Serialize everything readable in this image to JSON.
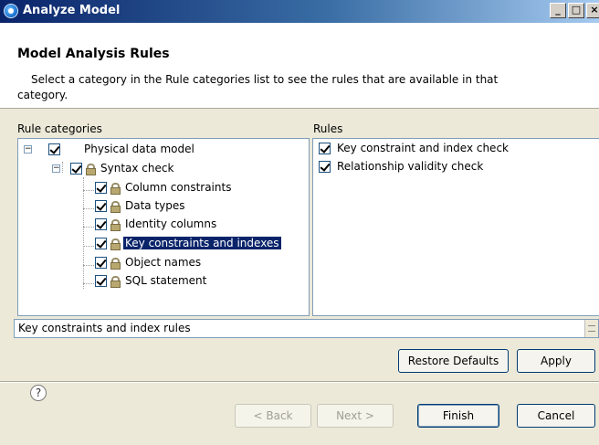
{
  "window": {
    "title": "Analyze Model",
    "buttons": [
      "_",
      "□",
      "×"
    ]
  },
  "header": {
    "title": "Model Analysis Rules",
    "description": "Select a category in the Rule categories list to see the rules that are available in that category."
  },
  "categories": {
    "label": "Rule categories",
    "root": {
      "label": "Physical data model",
      "checked": true
    },
    "group": {
      "label": "Syntax check",
      "checked": true
    },
    "items": [
      {
        "label": "Column constraints",
        "checked": true,
        "selected": false
      },
      {
        "label": "Data types",
        "checked": true,
        "selected": false
      },
      {
        "label": "Identity columns",
        "checked": true,
        "selected": false
      },
      {
        "label": "Key constraints and indexes",
        "checked": true,
        "selected": true
      },
      {
        "label": "Object names",
        "checked": true,
        "selected": false
      },
      {
        "label": "SQL statement",
        "checked": true,
        "selected": false
      }
    ]
  },
  "rules": {
    "label": "Rules",
    "items": [
      {
        "label": "Key constraint and index check",
        "checked": true
      },
      {
        "label": "Relationship validity check",
        "checked": true
      }
    ]
  },
  "description_field": {
    "value": "Key constraints and index rules"
  },
  "buttons": {
    "restore_defaults": "Restore Defaults",
    "apply": "Apply",
    "back": "< Back",
    "next": "Next >",
    "finish": "Finish",
    "cancel": "Cancel",
    "help": "?"
  },
  "icons": {
    "window": "analyze-model-icon",
    "lock": "lock-icon",
    "checkbox": "checkbox-checked-icon",
    "help": "help-icon"
  }
}
